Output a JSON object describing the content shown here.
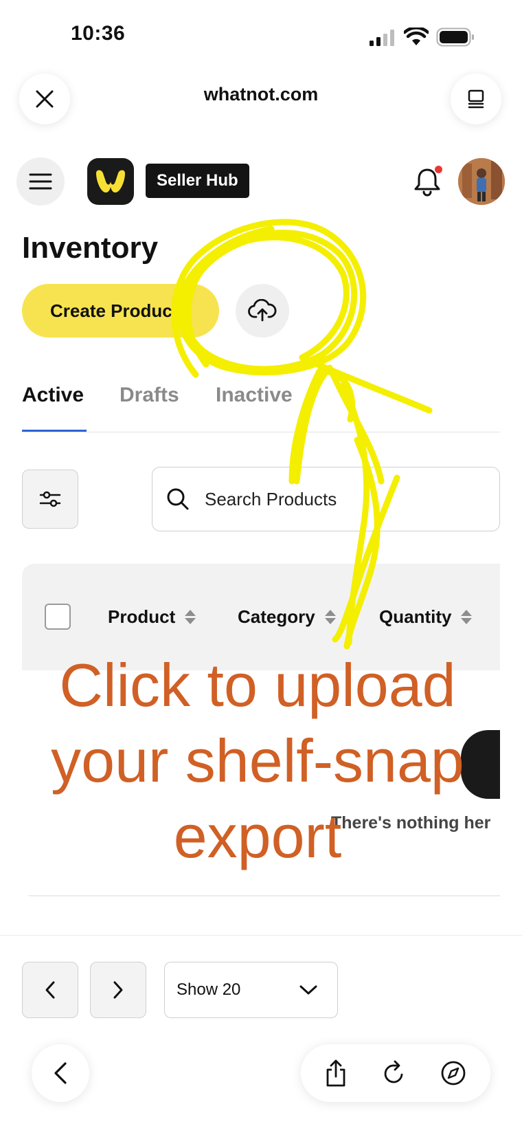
{
  "status_bar": {
    "time": "10:36"
  },
  "browser": {
    "url": "whatnot.com"
  },
  "header": {
    "seller_hub_label": "Seller Hub"
  },
  "page": {
    "title": "Inventory",
    "create_button_label": "Create Produc"
  },
  "tabs": [
    {
      "label": "Active",
      "active": true
    },
    {
      "label": "Drafts",
      "active": false
    },
    {
      "label": "Inactive",
      "active": false
    }
  ],
  "search": {
    "placeholder": "Search Products"
  },
  "table": {
    "columns": [
      "Product",
      "Category",
      "Quantity"
    ],
    "empty_message": "There's nothing her"
  },
  "pagination": {
    "page_size_label": "Show 20"
  },
  "annotation": {
    "lines": [
      "Click to upload",
      "your shelf-snap",
      "export"
    ],
    "text_color": "#d06025",
    "scribble_color": "#f4ee00"
  },
  "colors": {
    "accent_yellow": "#f7e34f",
    "tab_underline": "#2f63d6",
    "notification_dot": "#e53935"
  }
}
